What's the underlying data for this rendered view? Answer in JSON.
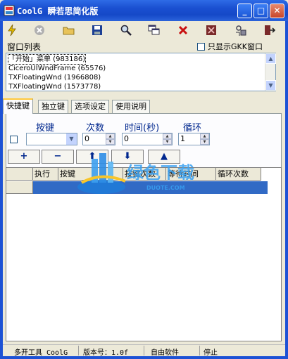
{
  "window": {
    "title": "CoolG 瞬若思简化版",
    "minimize": "_",
    "maximize": "□",
    "close": "✕"
  },
  "toolbar": {
    "icons": [
      "lightning-icon",
      "cancel-circle-icon",
      "open-folder-icon",
      "save-disk-icon",
      "magnifier-icon",
      "windows-icon",
      "delete-x-icon",
      "settings-chip-icon",
      "plugin-icon",
      "exit-icon"
    ]
  },
  "window_list": {
    "label": "窗口列表",
    "gkk_only_label": "只显示GKK窗口",
    "items": [
      "「开始」菜单 (983186)",
      "CiceroUIWndFrame (65576)",
      "TXFloatingWnd (1966808)",
      "TXFloatingWnd (1573778)"
    ]
  },
  "tabs": [
    "快捷键",
    "独立键",
    "选项设定",
    "使用说明"
  ],
  "params": {
    "key_label": "按键",
    "count_label": "次数",
    "time_label": "时间(秒)",
    "loop_label": "循环",
    "key_value": "",
    "count_value": "0",
    "time_value": "0",
    "loop_value": "1"
  },
  "actions": {
    "add": "+",
    "remove": "−",
    "up": "⬆",
    "down": "⬇",
    "top": "▲"
  },
  "grid": {
    "columns": [
      "执行",
      "按键",
      "按键次数",
      "等待时间",
      "循环次数"
    ]
  },
  "watermark": {
    "text": "绿色下载",
    "url": "DUOTE.COM"
  },
  "status": {
    "tool": "多开工具 CoolG",
    "version": "版本号：1.0f",
    "license": "自由软件",
    "state": "停止"
  },
  "colors": {
    "title_bar": "#1A4FD0",
    "selection": "#316AC5",
    "label_blue": "#00278E"
  }
}
